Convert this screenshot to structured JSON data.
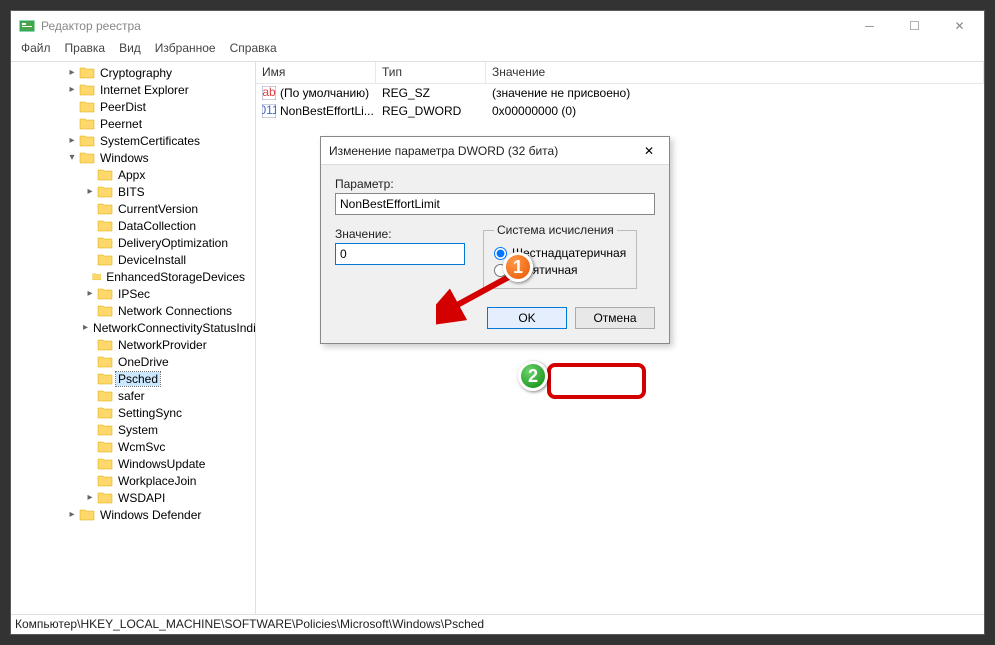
{
  "window": {
    "title": "Редактор реестра"
  },
  "menu": {
    "file": "Файл",
    "edit": "Правка",
    "view": "Вид",
    "favorites": "Избранное",
    "help": "Справка"
  },
  "tree": {
    "items": [
      {
        "indent": 3,
        "exp": ">",
        "label": "Cryptography"
      },
      {
        "indent": 3,
        "exp": ">",
        "label": "Internet Explorer"
      },
      {
        "indent": 3,
        "exp": "",
        "label": "PeerDist"
      },
      {
        "indent": 3,
        "exp": "",
        "label": "Peernet"
      },
      {
        "indent": 3,
        "exp": ">",
        "label": "SystemCertificates"
      },
      {
        "indent": 3,
        "exp": "v",
        "label": "Windows"
      },
      {
        "indent": 4,
        "exp": "",
        "label": "Appx"
      },
      {
        "indent": 4,
        "exp": ">",
        "label": "BITS"
      },
      {
        "indent": 4,
        "exp": "",
        "label": "CurrentVersion"
      },
      {
        "indent": 4,
        "exp": "",
        "label": "DataCollection"
      },
      {
        "indent": 4,
        "exp": "",
        "label": "DeliveryOptimization"
      },
      {
        "indent": 4,
        "exp": "",
        "label": "DeviceInstall"
      },
      {
        "indent": 4,
        "exp": "",
        "label": "EnhancedStorageDevices"
      },
      {
        "indent": 4,
        "exp": ">",
        "label": "IPSec"
      },
      {
        "indent": 4,
        "exp": "",
        "label": "Network Connections"
      },
      {
        "indent": 4,
        "exp": ">",
        "label": "NetworkConnectivityStatusIndicator"
      },
      {
        "indent": 4,
        "exp": "",
        "label": "NetworkProvider"
      },
      {
        "indent": 4,
        "exp": "",
        "label": "OneDrive"
      },
      {
        "indent": 4,
        "exp": "",
        "label": "Psched",
        "selected": true
      },
      {
        "indent": 4,
        "exp": "",
        "label": "safer"
      },
      {
        "indent": 4,
        "exp": "",
        "label": "SettingSync"
      },
      {
        "indent": 4,
        "exp": "",
        "label": "System"
      },
      {
        "indent": 4,
        "exp": "",
        "label": "WcmSvc"
      },
      {
        "indent": 4,
        "exp": "",
        "label": "WindowsUpdate"
      },
      {
        "indent": 4,
        "exp": "",
        "label": "WorkplaceJoin"
      },
      {
        "indent": 4,
        "exp": ">",
        "label": "WSDAPI"
      },
      {
        "indent": 3,
        "exp": ">",
        "label": "Windows Defender"
      }
    ]
  },
  "list": {
    "cols": {
      "name": "Имя",
      "type": "Тип",
      "value": "Значение"
    },
    "rows": [
      {
        "icon": "ab",
        "name": "(По умолчанию)",
        "type": "REG_SZ",
        "value": "(значение не присвоено)"
      },
      {
        "icon": "01",
        "name": "NonBestEffortLi...",
        "type": "REG_DWORD",
        "value": "0x00000000 (0)"
      }
    ]
  },
  "dialog": {
    "title": "Изменение параметра DWORD (32 бита)",
    "param_label": "Параметр:",
    "param_value": "NonBestEffortLimit",
    "value_label": "Значение:",
    "value_value": "0",
    "base_legend": "Система исчисления",
    "radio_hex": "Шестнадцатеричная",
    "radio_dec": "Десятичная",
    "ok": "OK",
    "cancel": "Отмена"
  },
  "statusbar": "Компьютер\\HKEY_LOCAL_MACHINE\\SOFTWARE\\Policies\\Microsoft\\Windows\\Psched",
  "badges": {
    "one": "1",
    "two": "2"
  }
}
